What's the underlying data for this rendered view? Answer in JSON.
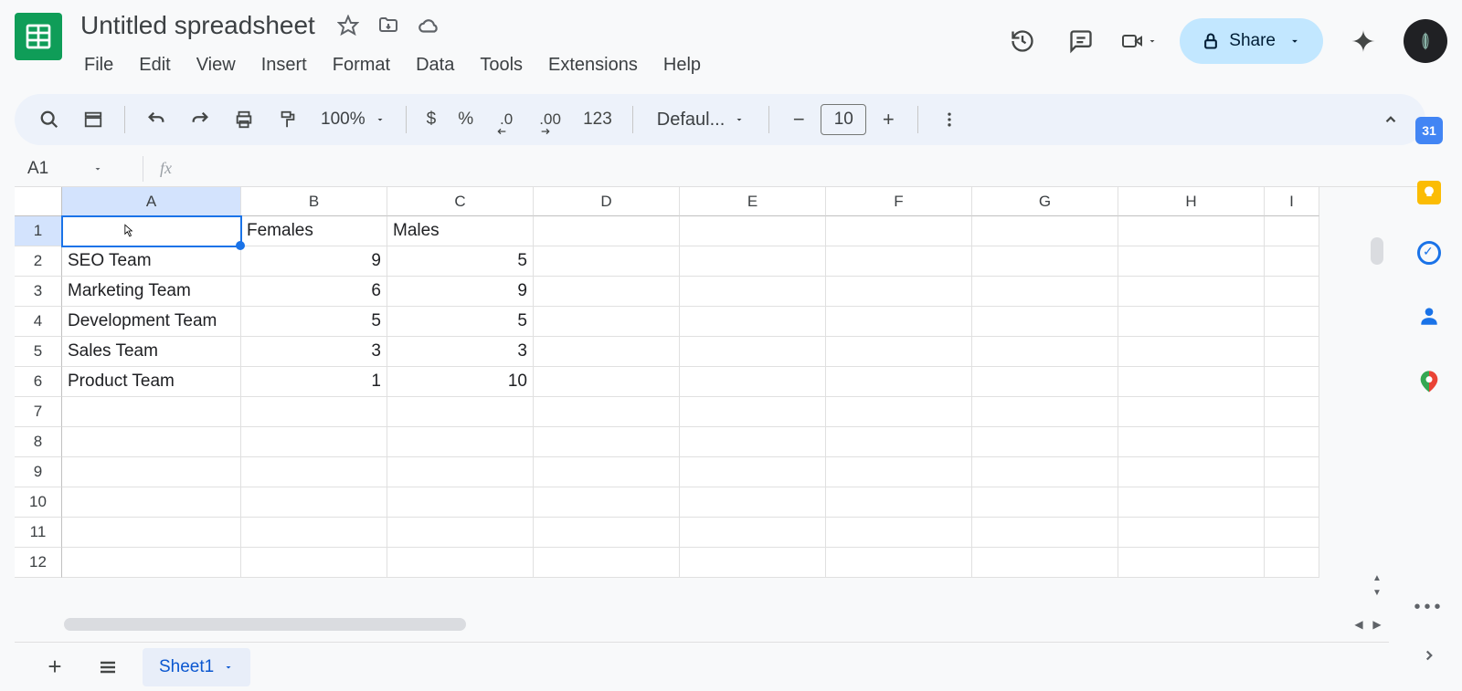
{
  "doc": {
    "title": "Untitled spreadsheet"
  },
  "menubar": [
    "File",
    "Edit",
    "View",
    "Insert",
    "Format",
    "Data",
    "Tools",
    "Extensions",
    "Help"
  ],
  "toolbar": {
    "zoom": "100%",
    "font": "Defaul...",
    "fontSize": "10",
    "currency": "$",
    "percent": "%",
    "dec_dec": ".0",
    "inc_dec": ".00",
    "num_fmt": "123"
  },
  "share": {
    "label": "Share"
  },
  "namebox": {
    "value": "A1"
  },
  "formula": {
    "fx": "fx",
    "value": ""
  },
  "columns": [
    "A",
    "B",
    "C",
    "D",
    "E",
    "F",
    "G",
    "H",
    "I"
  ],
  "rows": [
    "1",
    "2",
    "3",
    "4",
    "5",
    "6",
    "7",
    "8",
    "9",
    "10",
    "11",
    "12"
  ],
  "activeCell": "A1",
  "cells": {
    "B1": "Females",
    "C1": "Males",
    "A2": "SEO Team",
    "B2": "9",
    "C2": "5",
    "A3": "Marketing Team",
    "B3": "6",
    "C3": "9",
    "A4": "Development Team",
    "B4": "5",
    "C4": "5",
    "A5": "Sales Team",
    "B5": "3",
    "C5": "3",
    "A6": "Product Team",
    "B6": "1",
    "C6": "10"
  },
  "sheetTab": "Sheet1",
  "sideCalendar": "31"
}
